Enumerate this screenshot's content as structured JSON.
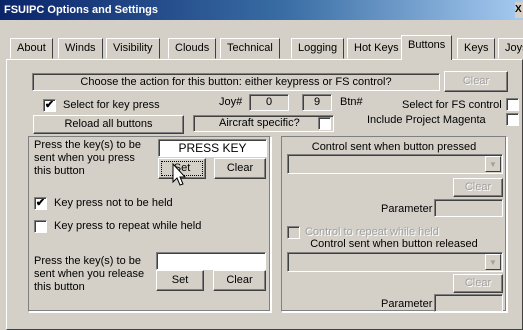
{
  "window": {
    "title": "FSUIPC Options and Settings",
    "close_glyph": "X"
  },
  "tabs": [
    "About",
    "Winds",
    "Visibility",
    "Clouds",
    "Technical",
    "Logging",
    "Hot Keys",
    "Buttons",
    "Keys",
    "Joysticks"
  ],
  "active_tab": "Buttons",
  "prompt": {
    "text": "Choose the action for this button: either keypress or FS control?",
    "clear": "Clear"
  },
  "select_key": {
    "label": "Select for key press",
    "checked": true
  },
  "joy": {
    "label": "Joy#",
    "value": "0"
  },
  "btn": {
    "value": "9",
    "label": "Btn#"
  },
  "select_fs": {
    "label": "Select for FS control",
    "checked": false
  },
  "reload_button": "Reload all buttons",
  "aircraft_specific": {
    "label": "Aircraft specific?",
    "checked": false
  },
  "project_magenta": {
    "label": "Include Project Magenta",
    "checked": false
  },
  "left_panel": {
    "press_label": "Press the key(s) to be sent when you press this button",
    "press_field": "PRESS KEY",
    "set": "Set",
    "clear": "Clear",
    "not_held": {
      "label": "Key press not to be held",
      "checked": true
    },
    "repeat_held": {
      "label": "Key press to repeat while held",
      "checked": false
    },
    "release_label": "Press the key(s) to be sent when you release this button",
    "release_field": "",
    "set2": "Set",
    "clear2": "Clear"
  },
  "right_panel": {
    "pressed_title": "Control sent when button pressed",
    "clear": "Clear",
    "parameter_label": "Parameter",
    "repeat_label": "Control to repeat while held",
    "repeat_checked": false,
    "released_title": "Control sent when button released",
    "clear2": "Clear",
    "parameter_label2": "Parameter"
  },
  "icons": {
    "cursor": "arrow-cursor-icon",
    "dropdown": "triangle-down-icon"
  }
}
